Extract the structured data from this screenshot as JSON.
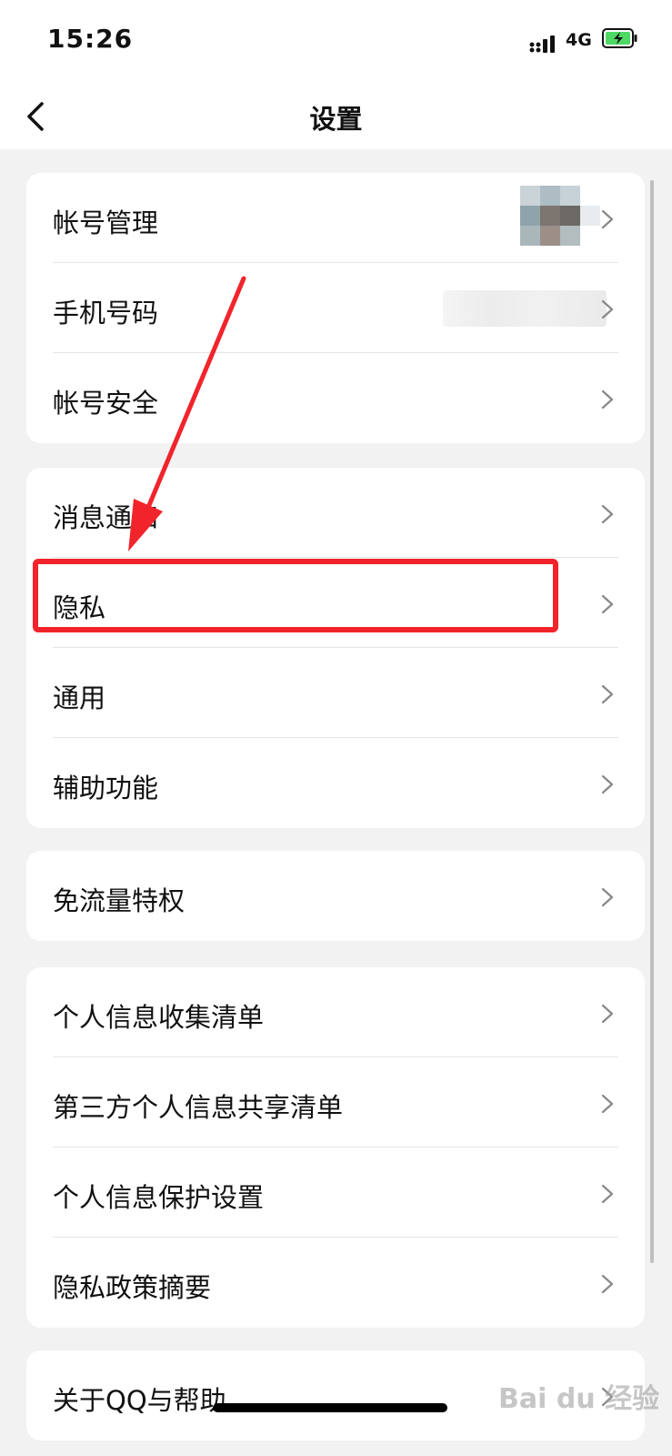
{
  "status_bar": {
    "time": "15:26",
    "network": "4G",
    "battery_icon": "battery-charging-icon",
    "battery_color": "#4cd964"
  },
  "nav": {
    "title": "设置",
    "back_icon": "chevron-left-icon"
  },
  "groups": [
    {
      "items": [
        {
          "label": "帐号管理"
        },
        {
          "label": "手机号码"
        },
        {
          "label": "帐号安全"
        }
      ]
    },
    {
      "items": [
        {
          "label": "消息通知"
        },
        {
          "label": "隐私"
        },
        {
          "label": "通用"
        },
        {
          "label": "辅助功能"
        }
      ]
    },
    {
      "items": [
        {
          "label": "免流量特权"
        }
      ]
    },
    {
      "items": [
        {
          "label": "个人信息收集清单"
        },
        {
          "label": "第三方个人信息共享清单"
        },
        {
          "label": "个人信息保护设置"
        },
        {
          "label": "隐私政策摘要"
        }
      ]
    },
    {
      "items": [
        {
          "label": "关于QQ与帮助"
        }
      ]
    }
  ],
  "annotation": {
    "highlight_color": "#f2242b",
    "highlighted_item": "隐私"
  },
  "watermark": {
    "text": "Bai du 经验"
  }
}
